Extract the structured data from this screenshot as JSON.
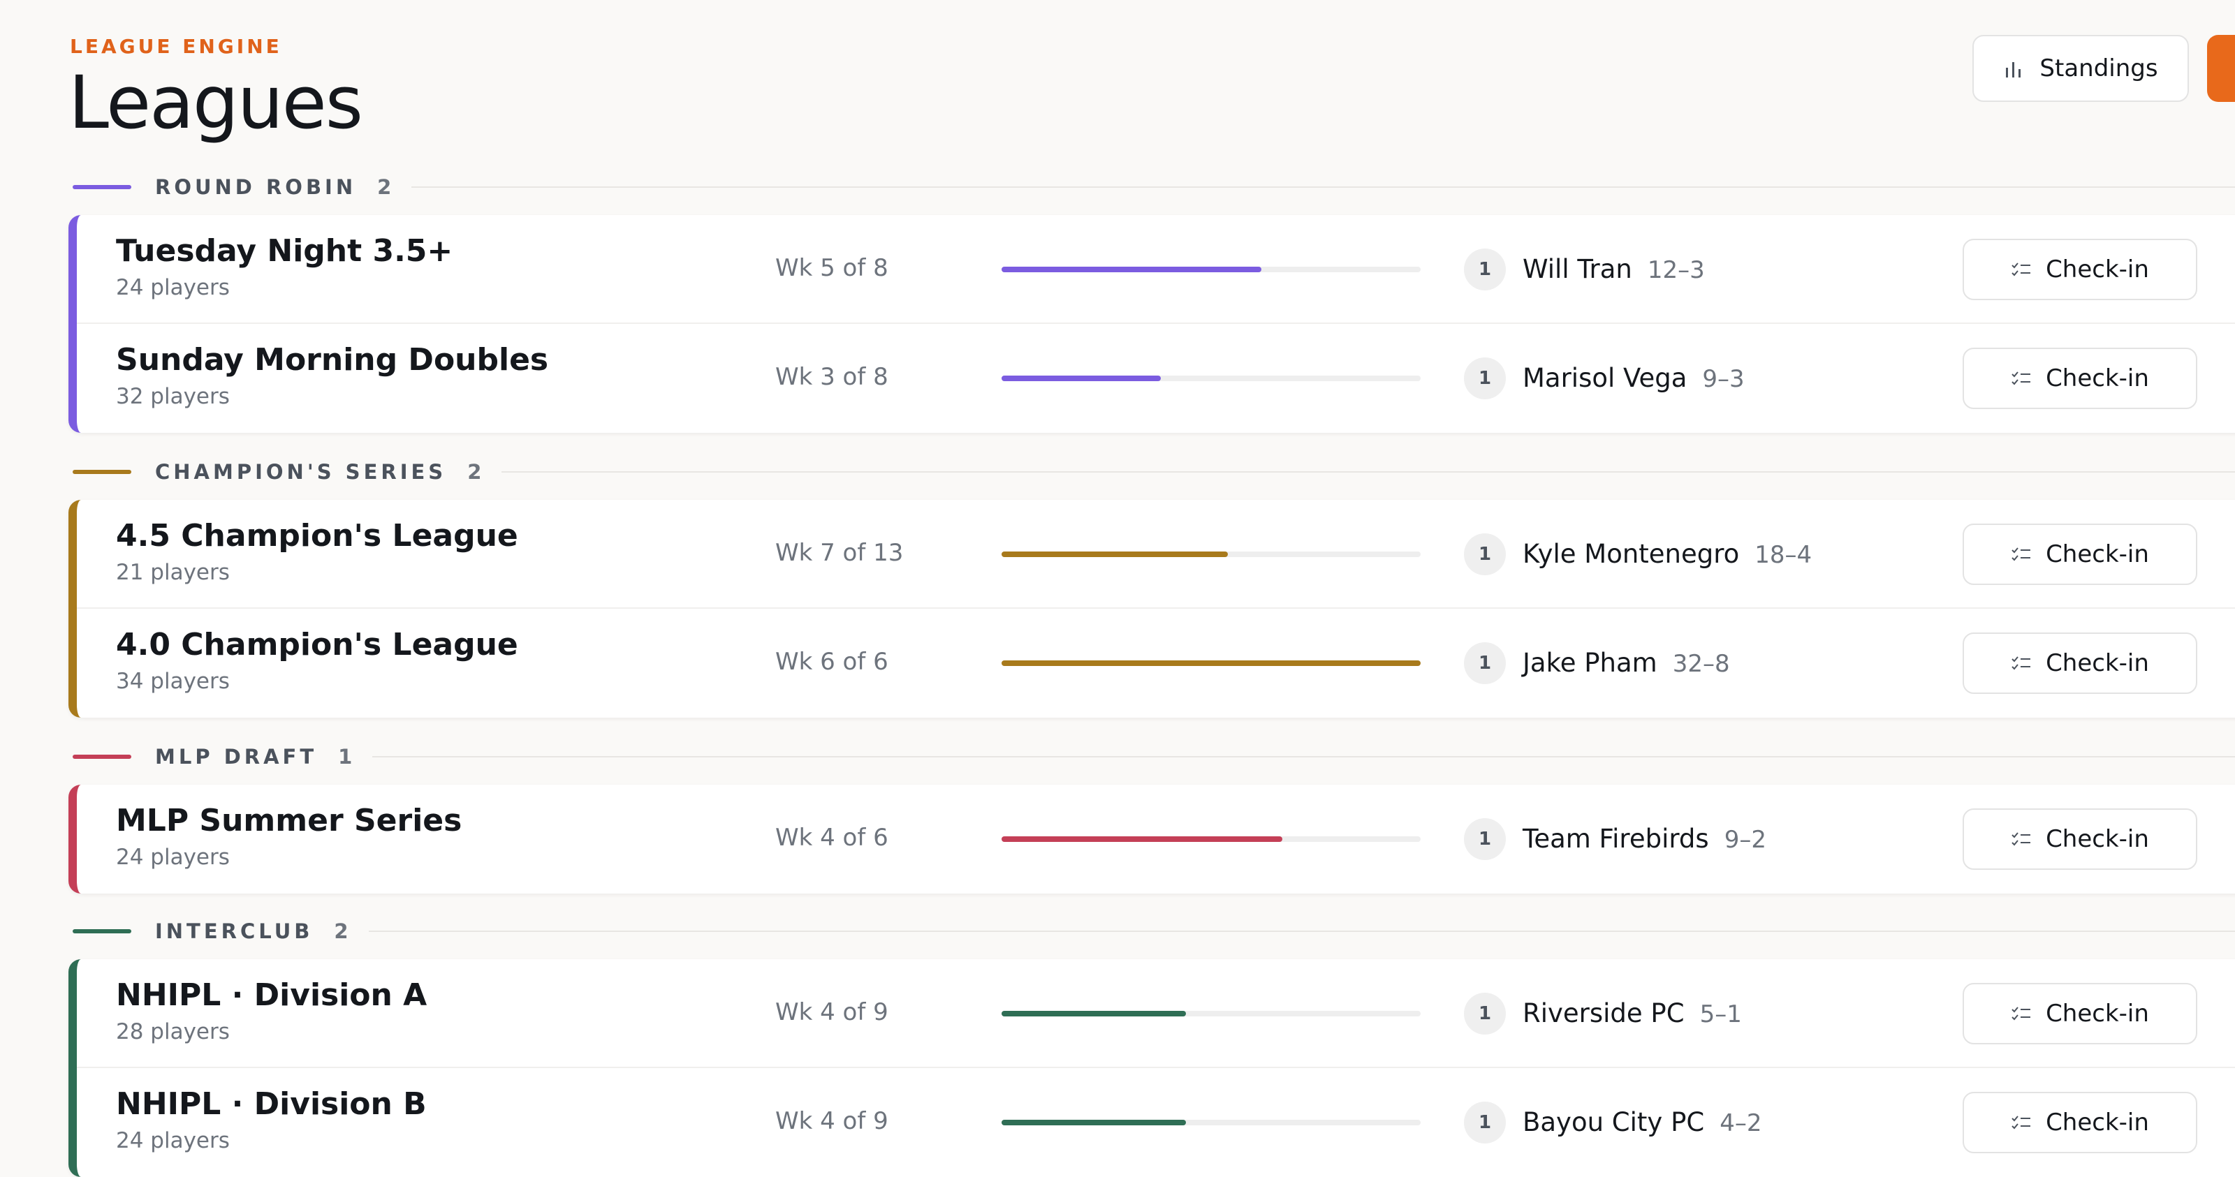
{
  "header": {
    "eyebrow": "LEAGUE ENGINE",
    "title": "Leagues",
    "standings_label": "Standings"
  },
  "groups": [
    {
      "name": "ROUND ROBIN",
      "count": "2",
      "color": "#7b5ce0",
      "leagues": [
        {
          "name": "Tuesday Night 3.5+",
          "players": "24 players",
          "week": "Wk 5 of 8",
          "progress": 0.62,
          "rank": "1",
          "leader": "Will Tran",
          "record": "12–3",
          "action": "Check-in"
        },
        {
          "name": "Sunday Morning Doubles",
          "players": "32 players",
          "week": "Wk 3 of 8",
          "progress": 0.38,
          "rank": "1",
          "leader": "Marisol Vega",
          "record": "9–3",
          "action": "Check-in"
        }
      ]
    },
    {
      "name": "CHAMPION'S SERIES",
      "count": "2",
      "color": "#a87a1c",
      "leagues": [
        {
          "name": "4.5 Champion's League",
          "players": "21 players",
          "week": "Wk 7 of 13",
          "progress": 0.54,
          "rank": "1",
          "leader": "Kyle Montenegro",
          "record": "18–4",
          "action": "Check-in"
        },
        {
          "name": "4.0 Champion's League",
          "players": "34 players",
          "week": "Wk 6 of 6",
          "progress": 1.0,
          "rank": "1",
          "leader": "Jake Pham",
          "record": "32–8",
          "action": "Check-in"
        }
      ]
    },
    {
      "name": "MLP DRAFT",
      "count": "1",
      "color": "#c43f57",
      "leagues": [
        {
          "name": "MLP Summer Series",
          "players": "24 players",
          "week": "Wk 4 of 6",
          "progress": 0.67,
          "rank": "1",
          "leader": "Team Firebirds",
          "record": "9–2",
          "action": "Check-in"
        }
      ]
    },
    {
      "name": "INTERCLUB",
      "count": "2",
      "color": "#2f6e55",
      "leagues": [
        {
          "name": "NHIPL · Division A",
          "players": "28 players",
          "week": "Wk 4 of 9",
          "progress": 0.44,
          "rank": "1",
          "leader": "Riverside PC",
          "record": "5–1",
          "action": "Check-in"
        },
        {
          "name": "NHIPL · Division B",
          "players": "24 players",
          "week": "Wk 4 of 9",
          "progress": 0.44,
          "rank": "1",
          "leader": "Bayou City PC",
          "record": "4–2",
          "action": "Check-in"
        }
      ]
    }
  ]
}
